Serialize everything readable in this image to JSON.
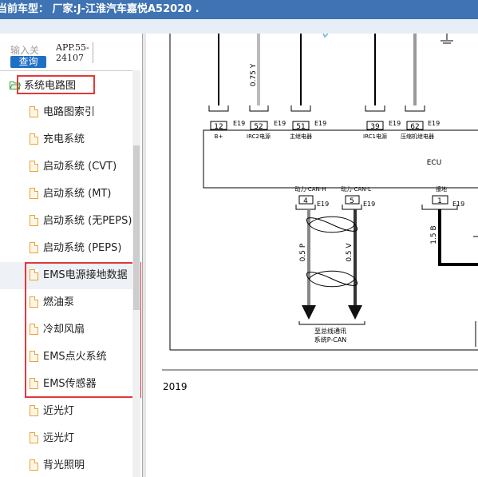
{
  "window": {
    "title": "当前车型： 厂家:J-江淮汽车嘉悦A52020 ."
  },
  "search": {
    "label": "输入关",
    "button": "查询",
    "app_code_line1": "APP.55-",
    "app_code_line2": "24107"
  },
  "tree": {
    "root": "系统电路图",
    "items": [
      {
        "label": "电路图索引"
      },
      {
        "label": "充电系统"
      },
      {
        "label": "启动系统 (CVT)"
      },
      {
        "label": "启动系统 (MT)"
      },
      {
        "label": "启动系统 (无PEPS)"
      },
      {
        "label": "启动系统 (PEPS)"
      },
      {
        "label": "EMS电源接地数据"
      },
      {
        "label": "燃油泵"
      },
      {
        "label": "冷却风扇"
      },
      {
        "label": "EMS点火系统"
      },
      {
        "label": "EMS传感器"
      },
      {
        "label": "近光灯"
      },
      {
        "label": "远光灯"
      },
      {
        "label": "背光照明"
      }
    ]
  },
  "diagram": {
    "wire_label_top": "0.75 Y",
    "ecu_label": "ECU",
    "pins_top": [
      {
        "num": "12",
        "conn": "E19",
        "name": "B+"
      },
      {
        "num": "52",
        "conn": "E19",
        "name": "IRC2电源"
      },
      {
        "num": "51",
        "conn": "E19",
        "name": "主继电器"
      },
      {
        "num": "39",
        "conn": "E19",
        "name": "IRC1电源"
      },
      {
        "num": "62",
        "conn": "E19",
        "name": "压缩机继电器"
      }
    ],
    "pins_bottom": [
      {
        "num": "4",
        "conn": "E19",
        "name": "动力-CAN-H"
      },
      {
        "num": "5",
        "conn": "E19",
        "name": "动力-CAN-L"
      },
      {
        "num": "1",
        "conn": "E19",
        "name": "接地"
      }
    ],
    "wire_canh": "0.5 P",
    "wire_canl": "0.5 V",
    "wire_gnd": "1.5 B",
    "bus_label_1": "至总线通讯",
    "bus_label_2": "系统P-CAN",
    "page_footer": "2019"
  },
  "colors": {
    "titlebar": "#3f73b3",
    "highlight": "#e03a3a",
    "button": "#1f6fc5"
  }
}
